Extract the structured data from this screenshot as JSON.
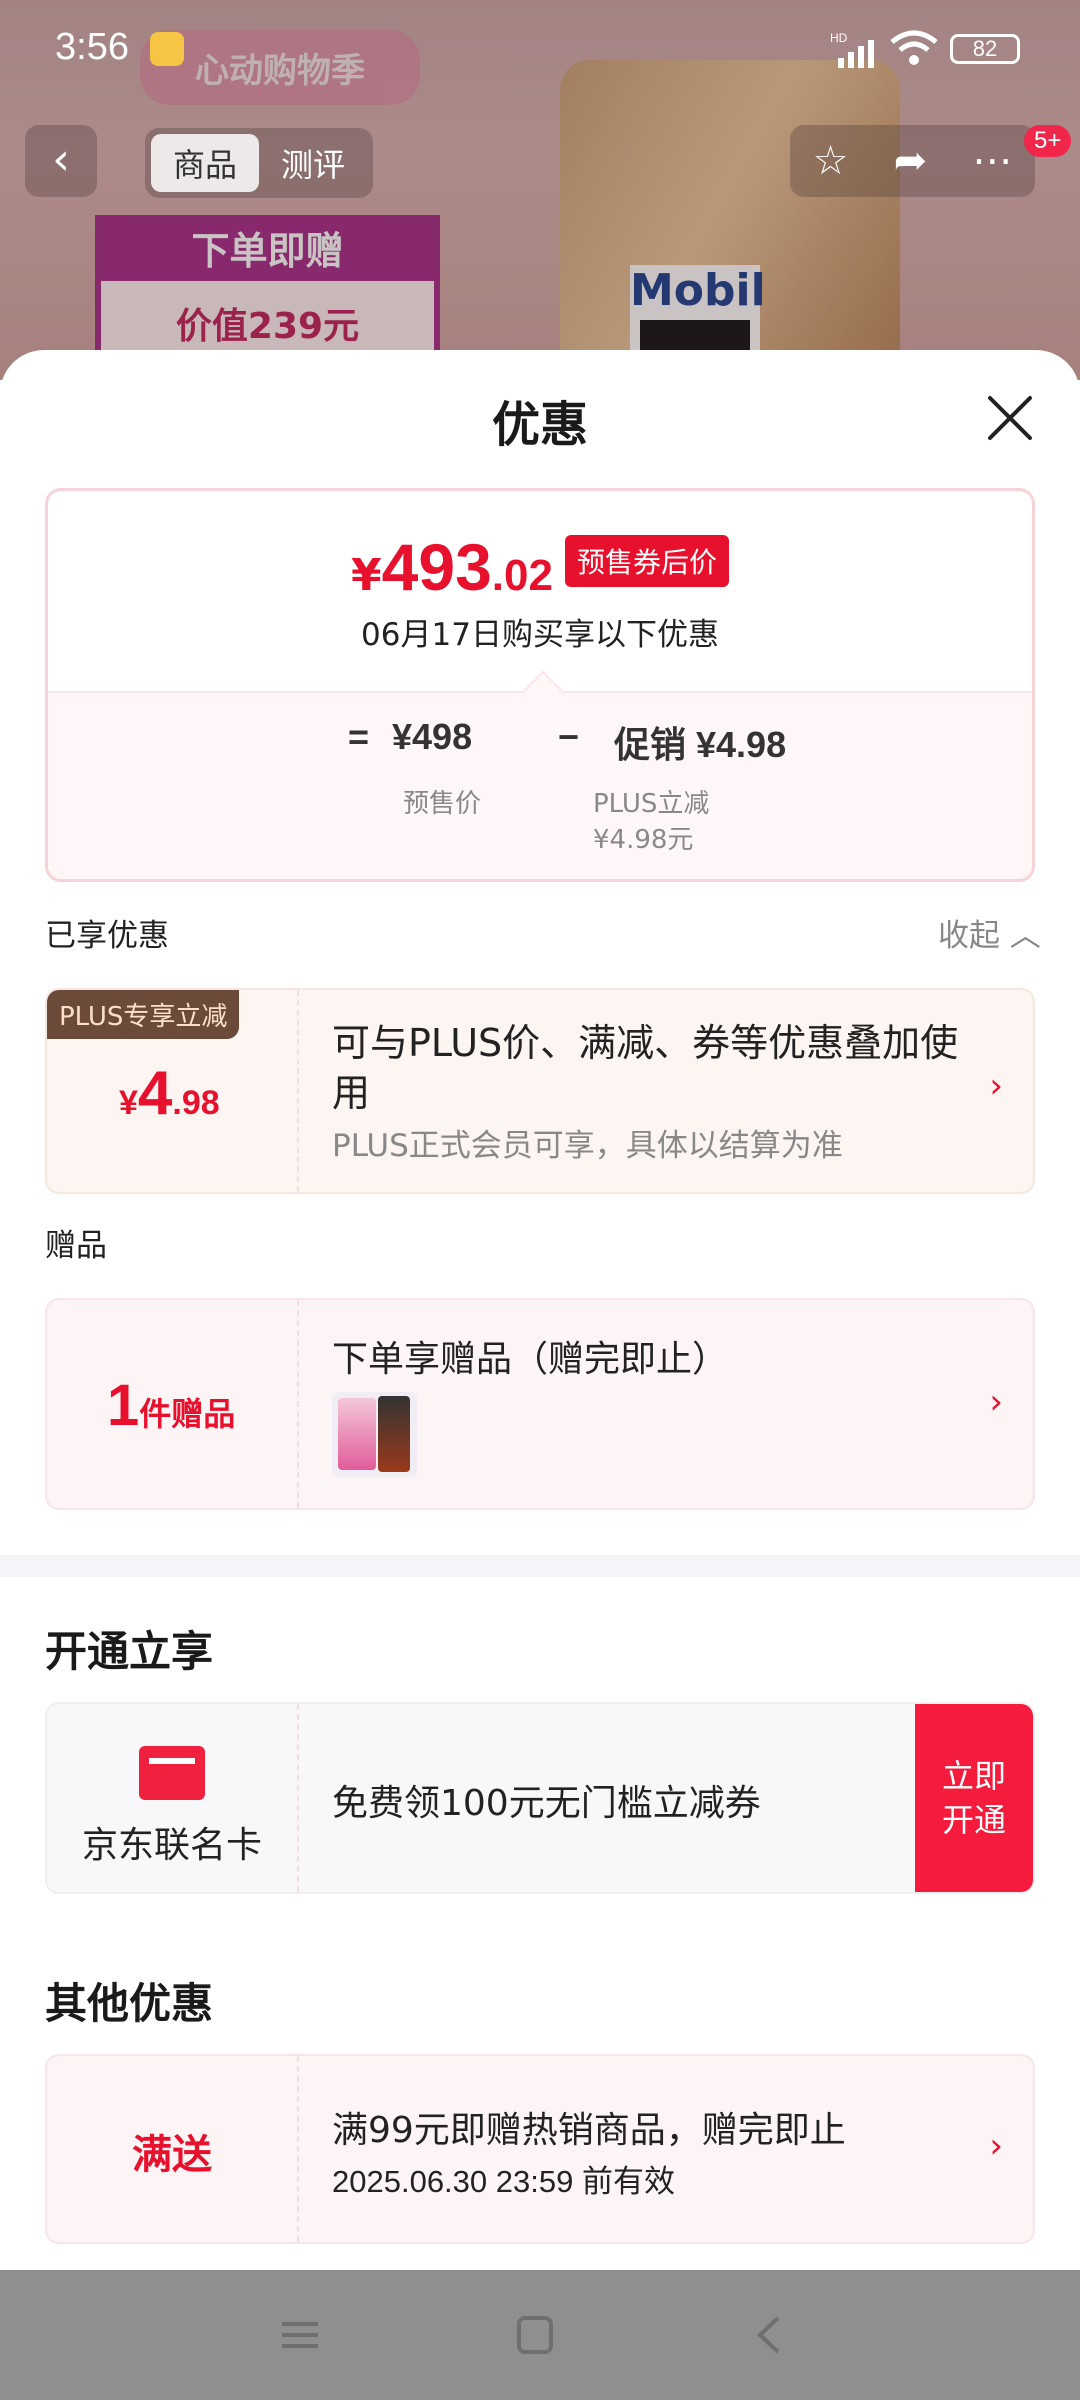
{
  "status_bar": {
    "time": "3:56",
    "battery": "82",
    "network_label": "HD"
  },
  "background_page": {
    "banner_text": "心动购物季",
    "tabs": [
      {
        "label": "商品"
      },
      {
        "label": "测评"
      }
    ],
    "badge": "5+",
    "promo_line1": "下单即赠",
    "promo_line2": "价值239元",
    "product_brand": "Mobil"
  },
  "sheet": {
    "title": "优惠",
    "summary": {
      "currency": "¥",
      "price_integer": "493",
      "price_decimal": ".02",
      "price_tag": "预售券后价",
      "purchase_note": "06月17日购买享以下优惠",
      "equals": "=",
      "presale_price": "¥498",
      "minus": "−",
      "promo_amount": "促销 ¥4.98",
      "presale_label": "预售价",
      "plus_label_line1": "PLUS立减",
      "plus_label_line2": "¥4.98元"
    },
    "enjoyed_section": {
      "label": "已享优惠",
      "collapse_label": "收起"
    },
    "plus_offer": {
      "tag": "PLUS专享立减",
      "currency": "¥",
      "amount_integer": "4",
      "amount_decimal": ".98",
      "description": "可与PLUS价、满减、券等优惠叠加使用",
      "note": "PLUS正式会员可享，具体以结算为准"
    },
    "gift_section": {
      "label": "赠品"
    },
    "gift": {
      "count": "1",
      "unit": "件赠品",
      "description": "下单享赠品（赠完即止）"
    },
    "open_section": {
      "title": "开通立享"
    },
    "card_offer": {
      "name": "京东联名卡",
      "description": "免费领100元无门槛立减券",
      "button_label": "立即开通"
    },
    "other_section": {
      "title": "其他优惠"
    },
    "other_offer": {
      "tag": "满送",
      "description": "满99元即赠热销商品，赠完即止",
      "validity": "2025.06.30 23:59 前有效"
    }
  },
  "colors": {
    "accent_red": "#e8112d",
    "plus_brown": "#6b4a3a"
  }
}
